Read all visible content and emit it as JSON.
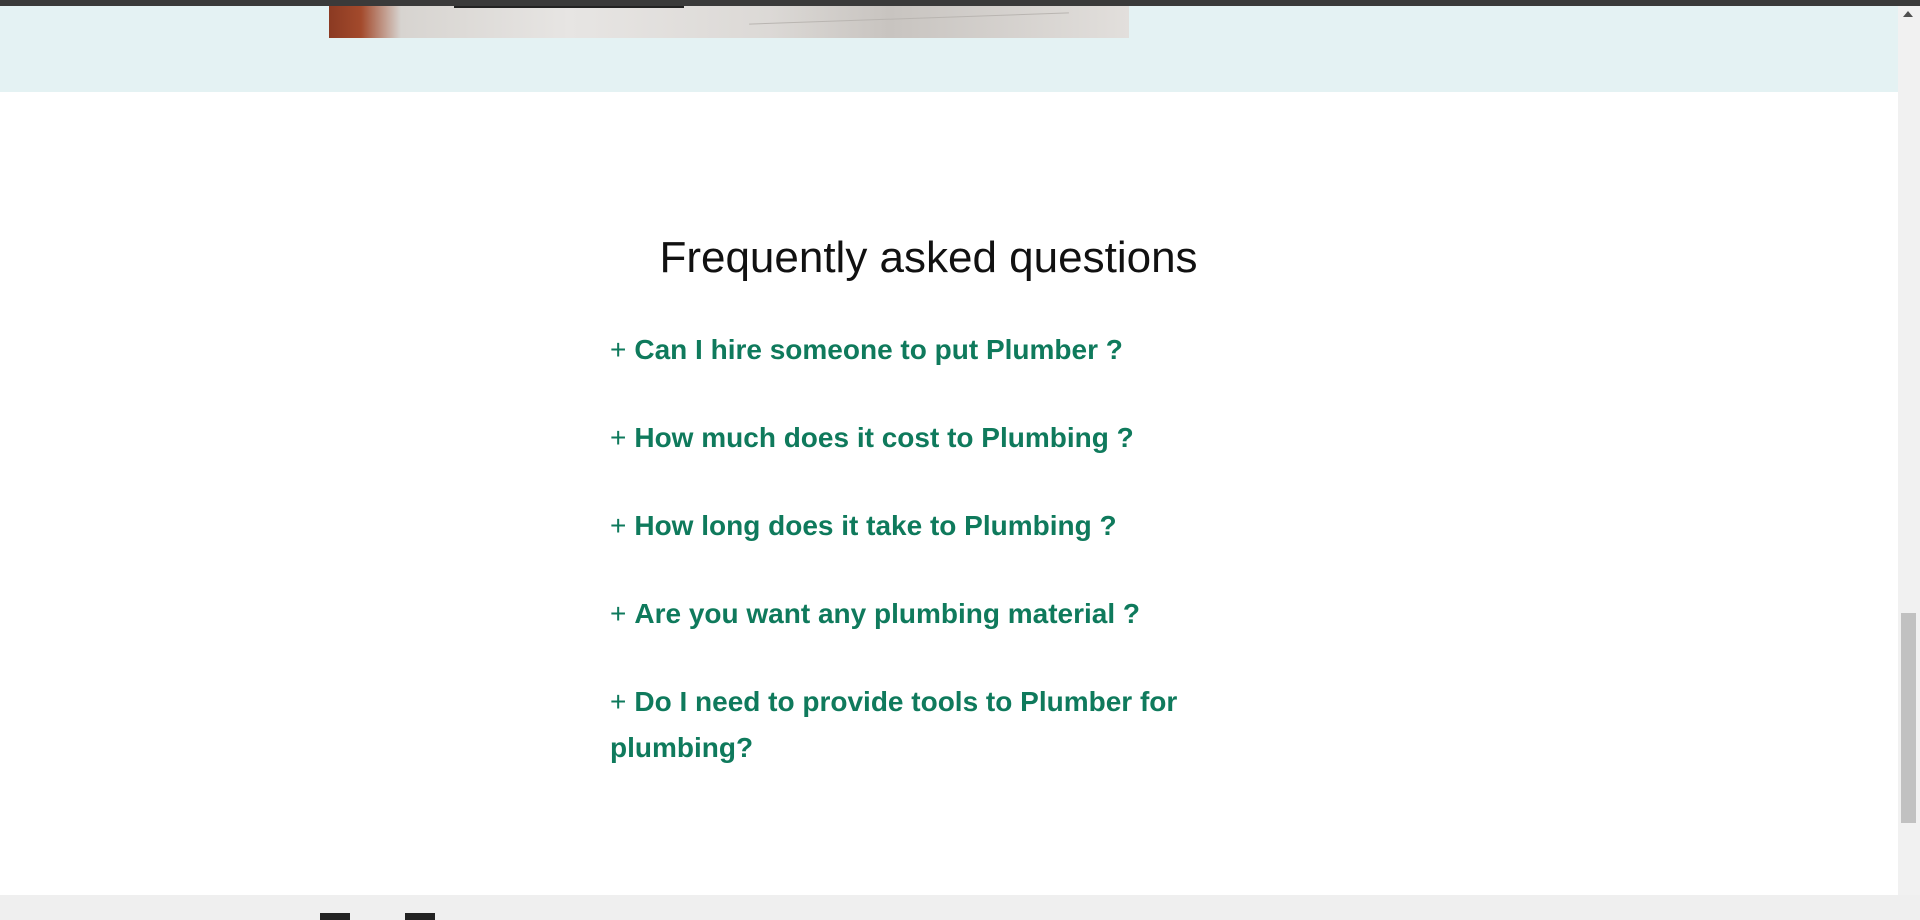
{
  "faq": {
    "title": "Frequently asked questions",
    "expand_symbol": "+",
    "items": [
      {
        "question": "Can I hire someone to put Plumber ?"
      },
      {
        "question": "How much does it cost to Plumbing ?"
      },
      {
        "question": "How long does it take to Plumbing ?"
      },
      {
        "question": "Are you want any plumbing material ?"
      },
      {
        "question": "Do I need to provide tools to Plumber for plumbing?"
      }
    ]
  },
  "colors": {
    "accent": "#0f7a5c",
    "hero_background": "#e4f2f3",
    "title": "#111111"
  },
  "icons": [
    "scroll-up-arrow-icon"
  ]
}
